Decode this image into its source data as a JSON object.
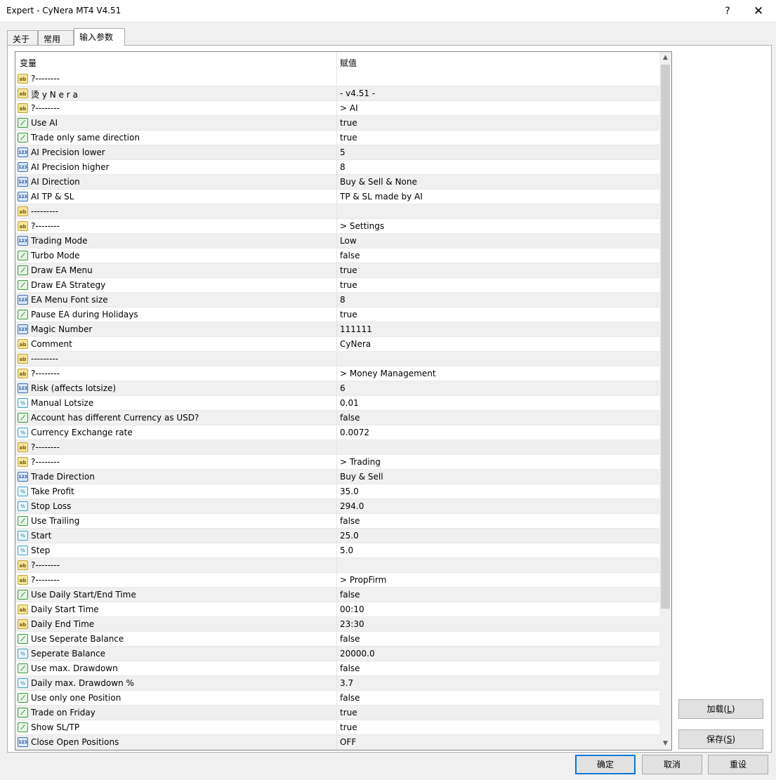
{
  "window": {
    "title": "Expert - CyNera MT4 V4.51",
    "help": "?",
    "close": "✕"
  },
  "tabs": [
    {
      "label": "关于"
    },
    {
      "label": "常用"
    },
    {
      "label": "输入参数"
    }
  ],
  "grid": {
    "col_variable": "变量",
    "col_value": "赋值",
    "rows": [
      {
        "type": "ab",
        "name": "?--------",
        "value": ""
      },
      {
        "type": "ab",
        "name": "烫 y N e r a",
        "value": "-    v4.51    -"
      },
      {
        "type": "ab",
        "name": "?--------",
        "value": "  > AI"
      },
      {
        "type": "bool",
        "name": "Use AI",
        "value": "true"
      },
      {
        "type": "bool",
        "name": "Trade only same direction",
        "value": "true"
      },
      {
        "type": "int",
        "name": "AI Precision lower",
        "value": "5"
      },
      {
        "type": "int",
        "name": "AI Precision higher",
        "value": "8"
      },
      {
        "type": "int",
        "name": "AI Direction",
        "value": "Buy & Sell & None"
      },
      {
        "type": "int",
        "name": "AI TP & SL",
        "value": "TP & SL made by AI"
      },
      {
        "type": "ab",
        "name": "---------",
        "value": ""
      },
      {
        "type": "ab",
        "name": "?--------",
        "value": "  > Settings"
      },
      {
        "type": "int",
        "name": "Trading Mode",
        "value": "Low"
      },
      {
        "type": "bool",
        "name": "Turbo Mode",
        "value": "false"
      },
      {
        "type": "bool",
        "name": "Draw EA Menu",
        "value": "true"
      },
      {
        "type": "bool",
        "name": "Draw EA Strategy",
        "value": "true"
      },
      {
        "type": "int",
        "name": "EA Menu Font size",
        "value": "8"
      },
      {
        "type": "bool",
        "name": "Pause EA during Holidays",
        "value": "true"
      },
      {
        "type": "int",
        "name": "Magic Number",
        "value": "111111"
      },
      {
        "type": "ab",
        "name": "Comment",
        "value": "CyNera"
      },
      {
        "type": "ab",
        "name": "---------",
        "value": ""
      },
      {
        "type": "ab",
        "name": "?--------",
        "value": "  > Money Management"
      },
      {
        "type": "int",
        "name": "Risk (affects lotsize)",
        "value": "6"
      },
      {
        "type": "dbl",
        "name": "Manual Lotsize",
        "value": "0.01"
      },
      {
        "type": "bool",
        "name": "Account has different Currency as USD?",
        "value": "false"
      },
      {
        "type": "dbl",
        "name": "Currency Exchange rate",
        "value": "0.0072"
      },
      {
        "type": "ab",
        "name": "?--------",
        "value": ""
      },
      {
        "type": "ab",
        "name": "?--------",
        "value": "  > Trading"
      },
      {
        "type": "int",
        "name": "Trade Direction",
        "value": "Buy & Sell"
      },
      {
        "type": "dbl",
        "name": "Take Profit",
        "value": "35.0"
      },
      {
        "type": "dbl",
        "name": "Stop Loss",
        "value": "294.0"
      },
      {
        "type": "bool",
        "name": "Use Trailing",
        "value": "false"
      },
      {
        "type": "dbl",
        "name": "Start",
        "value": "25.0"
      },
      {
        "type": "dbl",
        "name": "Step",
        "value": "5.0"
      },
      {
        "type": "ab",
        "name": "?--------",
        "value": ""
      },
      {
        "type": "ab",
        "name": "?--------",
        "value": "  > PropFirm"
      },
      {
        "type": "bool",
        "name": "Use Daily Start/End Time",
        "value": "false"
      },
      {
        "type": "ab",
        "name": "Daily Start Time",
        "value": "00:10"
      },
      {
        "type": "ab",
        "name": "Daily End Time",
        "value": "23:30"
      },
      {
        "type": "bool",
        "name": "Use Seperate Balance",
        "value": "false"
      },
      {
        "type": "dbl",
        "name": "Seperate Balance",
        "value": "20000.0"
      },
      {
        "type": "bool",
        "name": "Use max. Drawdown",
        "value": "false"
      },
      {
        "type": "dbl",
        "name": "Daily max. Drawdown %",
        "value": "3.7"
      },
      {
        "type": "bool",
        "name": "Use only one Position",
        "value": "false"
      },
      {
        "type": "bool",
        "name": "Trade on Friday",
        "value": "true"
      },
      {
        "type": "bool",
        "name": "Show SL/TP",
        "value": "true"
      },
      {
        "type": "int",
        "name": "Close Open Positions",
        "value": "OFF"
      }
    ]
  },
  "icons": {
    "ab": "ab",
    "bool": "⟋",
    "int": "123",
    "dbl": "½"
  },
  "buttons": {
    "load": {
      "text": "加载(",
      "key": "L",
      "end": ")"
    },
    "save": {
      "text": "保存(",
      "key": "S",
      "end": ")"
    },
    "ok": "确定",
    "cancel": "取消",
    "reset": "重设"
  }
}
